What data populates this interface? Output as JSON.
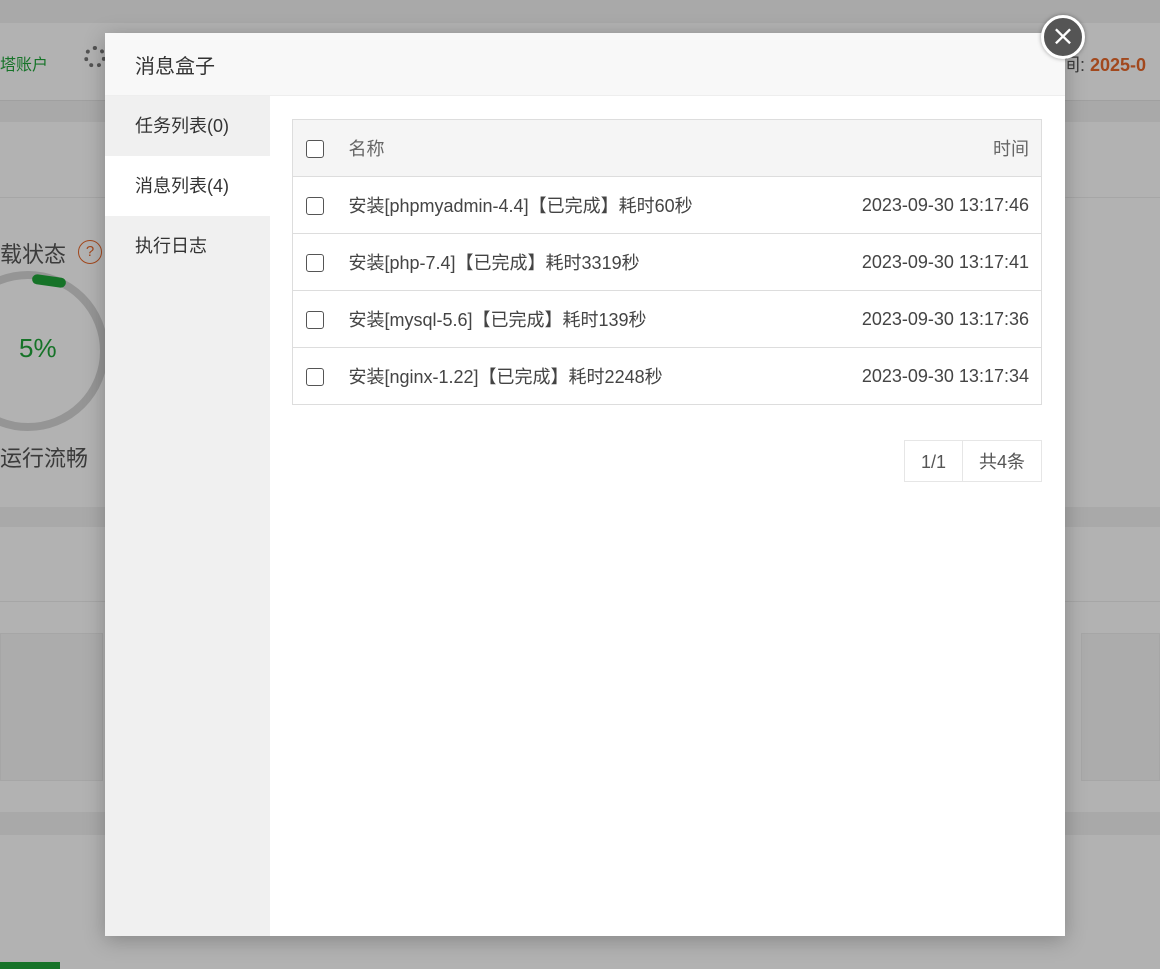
{
  "background": {
    "account_label": "塔账户",
    "time_label": "间: ",
    "time_value": "2025-0",
    "load_title": "载状态",
    "help_icon": "?",
    "load_percent": "5%",
    "load_state": "运行流畅"
  },
  "modal": {
    "title": "消息盒子",
    "close_glyph": "×",
    "sidebar": [
      {
        "label": "任务列表(0)"
      },
      {
        "label": "消息列表(4)"
      },
      {
        "label": "执行日志"
      }
    ],
    "active_tab": 1,
    "table": {
      "headers": {
        "name": "名称",
        "time": "时间"
      },
      "rows": [
        {
          "name": "安装[phpmyadmin-4.4]【已完成】耗时60秒",
          "time": "2023-09-30 13:17:46"
        },
        {
          "name": "安装[php-7.4]【已完成】耗时3319秒",
          "time": "2023-09-30 13:17:41"
        },
        {
          "name": "安装[mysql-5.6]【已完成】耗时139秒",
          "time": "2023-09-30 13:17:36"
        },
        {
          "name": "安装[nginx-1.22]【已完成】耗时2248秒",
          "time": "2023-09-30 13:17:34"
        }
      ]
    },
    "pagination": {
      "page": "1/1",
      "total": "共4条"
    }
  },
  "colors": {
    "accent_green": "#20a53a",
    "accent_orange": "#e8672a"
  }
}
